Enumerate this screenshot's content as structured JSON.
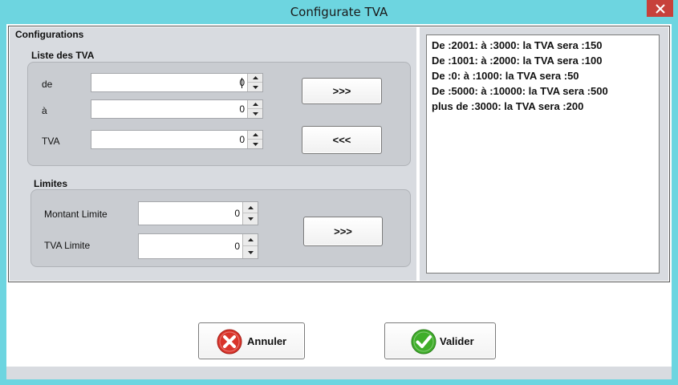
{
  "window": {
    "title": "Configurate TVA"
  },
  "configurations": {
    "title": "Configurations",
    "liste": {
      "title": "Liste des TVA",
      "de_label": "de",
      "de_value": "0",
      "a_label": "à",
      "a_value": "0",
      "tva_label": "TVA",
      "tva_value": "0",
      "add_button": ">>>",
      "remove_button": "<<<"
    },
    "limites": {
      "title": "Limites",
      "montant_label": "Montant Limite",
      "montant_value": "0",
      "tva_limite_label": "TVA Limite",
      "tva_limite_value": "0",
      "apply_button": ">>>"
    },
    "tva_list": [
      "De :2001: à :3000: la TVA sera :150",
      "De :1001: à :2000: la TVA sera :100",
      "De :0: à :1000: la TVA sera :50",
      "De :5000: à :10000: la TVA sera :500",
      "plus de :3000: la TVA sera :200"
    ]
  },
  "actions": {
    "cancel_label": "Annuler",
    "validate_label": "Valider"
  },
  "icons": {
    "close": "close-icon",
    "spin_up": "spin-up-icon",
    "spin_down": "spin-down-icon",
    "cancel": "cancel-icon",
    "validate": "check-icon"
  },
  "colors": {
    "titlebar": "#6dd5e0",
    "close_button": "#c7413b",
    "panel": "#d8dbe0",
    "cancel_icon": "#d9342b",
    "validate_icon": "#3fae2a"
  }
}
